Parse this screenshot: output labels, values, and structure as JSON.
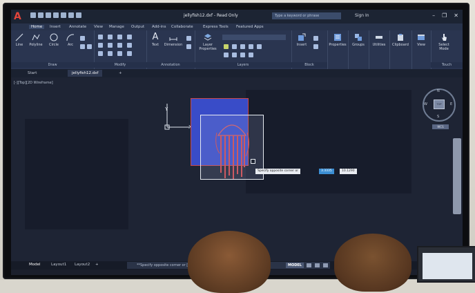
{
  "app": {
    "logo_letter": "A",
    "document_title": "jellyfish12.dxf - Read Only",
    "search_placeholder": "Type a keyword or phrase",
    "sign_in": "Sign In"
  },
  "ribbon_tabs": [
    "Home",
    "Insert",
    "Annotate",
    "View",
    "Manage",
    "Output",
    "Add-ins",
    "Collaborate",
    "Express Tools",
    "Featured Apps"
  ],
  "ribbon": {
    "draw_tools": [
      "Line",
      "Polyline",
      "Circle",
      "Arc"
    ],
    "draw_title": "Draw",
    "modify_title": "Modify",
    "annotation_tools": [
      "Text",
      "Dimension"
    ],
    "annotation_title": "Annotation",
    "layer_tool": "Layer Properties",
    "layers_title": "Layers",
    "insert_tool": "Insert",
    "block_title": "Block",
    "right_tools": [
      "Properties",
      "Groups",
      "Utilities",
      "Clipboard",
      "View",
      "Select Mode"
    ],
    "touch_title": "Touch"
  },
  "file_tabs": [
    "Start",
    "jellyfish12.dxf"
  ],
  "viewport": {
    "label": "[-][Top][2D Wireframe]",
    "ucs_y": "Y",
    "ucs_x": "X",
    "prompt": "Specify opposite corner or",
    "dyn_value1": "3.3335",
    "dyn_value2": "10.1290",
    "viewcube": {
      "north": "N",
      "south": "S",
      "east": "E",
      "west": "W",
      "face": "TOP",
      "wcs": "WCS"
    }
  },
  "bottom": {
    "layout_tabs": [
      "Model",
      "Layout1",
      "Layout2"
    ],
    "command_text": "**Specify opposite corner or [Fence WPolygon CPolygon]:",
    "model_label": "MODEL"
  },
  "colors": {
    "accent": "#3c8fd4",
    "image_fill": "#3b4fd0",
    "image_border": "#d64a4a"
  }
}
